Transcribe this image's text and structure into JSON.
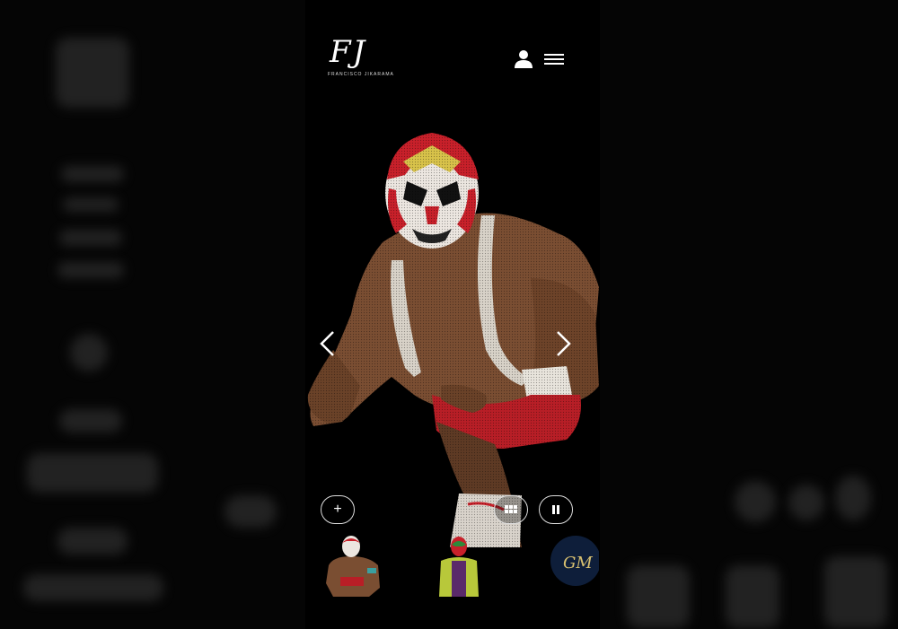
{
  "header": {
    "logo_mark": "FJ",
    "logo_subtitle": "FRANCISCO JIKARAMA",
    "user_icon": "user-icon",
    "menu_icon": "hamburger-menu-icon"
  },
  "hero": {
    "subject": "masked wrestler"
  },
  "controls": {
    "add_label": "+",
    "grid_icon": "grid-icon",
    "pause_icon": "pause-icon",
    "prev_icon": "chevron-left-icon",
    "next_icon": "chevron-right-icon"
  },
  "thumbnails": [
    {
      "name": "thumb-wrestler-red-mask"
    },
    {
      "name": "thumb-wrestler-green-mask"
    },
    {
      "name": "thumb-logo-badge"
    }
  ],
  "colors": {
    "background": "#000000",
    "mask_red": "#c8202a",
    "mask_white": "#ece6e0",
    "trunks_red": "#b81e26",
    "skin": "#7a4e32"
  }
}
